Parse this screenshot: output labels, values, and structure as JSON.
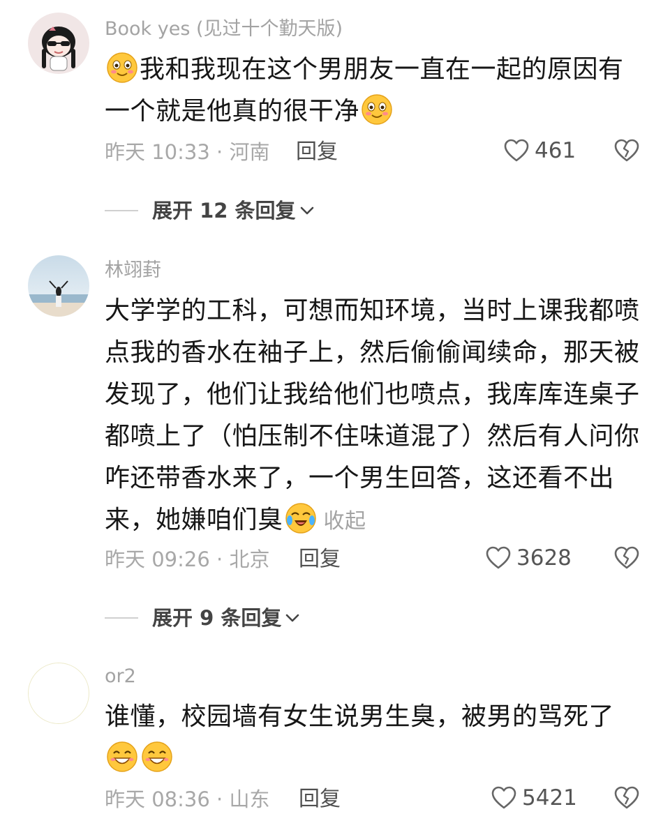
{
  "comments": [
    {
      "username": "Book yes (见过十个勤天版)",
      "avatar_icon": "anime-girl-avatar-icon",
      "text_lines": [
        "我和我现在这个男朋友一直在一起的原因有",
        "一个就是他真的很干净"
      ],
      "time_location": "昨天 10:33 · 河南",
      "reply_label": "回复",
      "likes": "461",
      "expand_label": "展开 12 条回复"
    },
    {
      "username": "林翊葑",
      "avatar_icon": "beach-photo-avatar-icon",
      "text_lines": [
        "大学学的工科，可想而知环境，当时上课我都喷",
        "点我的香水在袖子上，然后偷偷闻续命，那天被",
        "发现了，他们让我给他们也喷点，我库库连桌子",
        "都喷上了（怕压制不住味道混了）然后有人问你",
        "咋还带香水来了，一个男生回答，这还看不出",
        "来，她嫌咱们臭"
      ],
      "collapse_label": "收起",
      "time_location": "昨天 09:26 · 北京",
      "reply_label": "回复",
      "likes": "3628",
      "expand_label": "展开 9 条回复"
    },
    {
      "username": "or2",
      "avatar_icon": "blank-avatar-icon",
      "text_lines": [
        "谁懂，校园墙有女生说男生臭，被男的骂死了"
      ],
      "time_location": "昨天 08:36 · 山东",
      "reply_label": "回复",
      "likes": "5421"
    }
  ],
  "icons": {
    "like": "heart-outline-icon",
    "dislike": "broken-heart-icon",
    "expand": "chevron-down-icon",
    "emoji_shy": "shy-smile-emoji",
    "emoji_cry": "crying-laugh-emoji",
    "emoji_grin": "grin-emoji"
  },
  "colors": {
    "username": "#a3a3a3",
    "body": "#161616",
    "meta": "#a8a8a8",
    "emoji_yellow": "#ffc83d"
  }
}
